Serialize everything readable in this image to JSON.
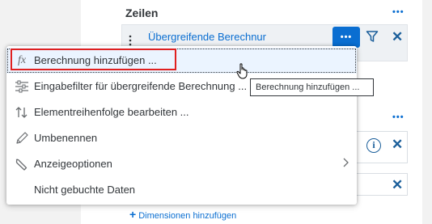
{
  "rows_section": {
    "title": "Zeilen",
    "row_label": "Übergreifende Berechnur"
  },
  "add_dimensions": {
    "label": "Dimensionen hinzufügen"
  },
  "menu": {
    "items": [
      {
        "label": "Berechnung hinzufügen ...",
        "icon": "fx-icon"
      },
      {
        "label": "Eingabefilter für übergreifende Berechnung ...",
        "icon": "input-filter-icon"
      },
      {
        "label": "Elementreihenfolge bearbeiten ...",
        "icon": "sort-order-icon"
      },
      {
        "label": "Umbenennen",
        "icon": "pencil-icon"
      },
      {
        "label": "Anzeigeoptionen",
        "icon": "wrench-icon"
      },
      {
        "label": "Nicht gebuchte Daten",
        "icon": ""
      }
    ]
  },
  "tooltip": {
    "text": "Berechnung hinzufügen ..."
  },
  "colors": {
    "accent": "#0a6ed1",
    "highlight": "#e02020",
    "icon": "#1a5e9a"
  }
}
